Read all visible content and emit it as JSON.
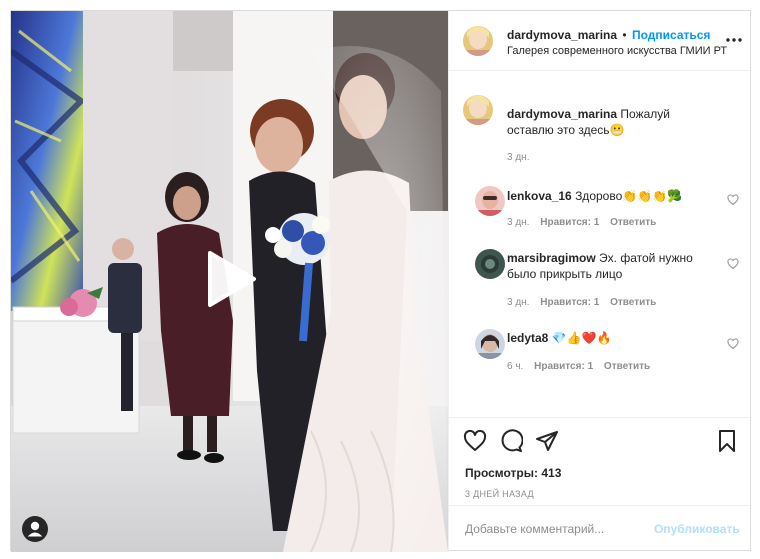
{
  "post": {
    "author": "dardymova_marina",
    "separator": "•",
    "follow_label": "Подписаться",
    "location": "Галерея современного искусства ГМИИ РТ",
    "caption": {
      "username": "dardymova_marina",
      "text": "Пожалуй оставлю это здесь",
      "emoji": "😬",
      "time": "3 дн."
    },
    "comments": [
      {
        "username": "lenkova_16",
        "text": "Здорово👏👏👏🥦",
        "time": "3 дн.",
        "likes": "Нравится: 1",
        "reply": "Ответить"
      },
      {
        "username": "marsibragimow",
        "text": "Эх. фатой нужно было прикрыть лицо",
        "time": "3 дн.",
        "likes": "Нравится: 1",
        "reply": "Ответить"
      },
      {
        "username": "ledyta8",
        "text": "💎👍❤️🔥",
        "time": "6 ч.",
        "likes": "Нравится: 1",
        "reply": "Ответить"
      }
    ],
    "views_label": "Просмотры:",
    "views_count": "413",
    "date": "3 ДНЕЙ НАЗАД",
    "comment_placeholder": "Добавьте комментарий...",
    "publish_label": "Опубликовать"
  },
  "icons": {
    "more": "more-options-icon",
    "like": "heart-icon",
    "comment": "comment-bubble-icon",
    "share": "paper-plane-icon",
    "save": "bookmark-icon",
    "play": "play-icon",
    "profile": "user-icon"
  },
  "colors": {
    "link_blue": "#0095f6",
    "publish_disabled": "#b2dffc",
    "secondary_text": "#8e8e8e",
    "border": "#dbdbdb"
  }
}
